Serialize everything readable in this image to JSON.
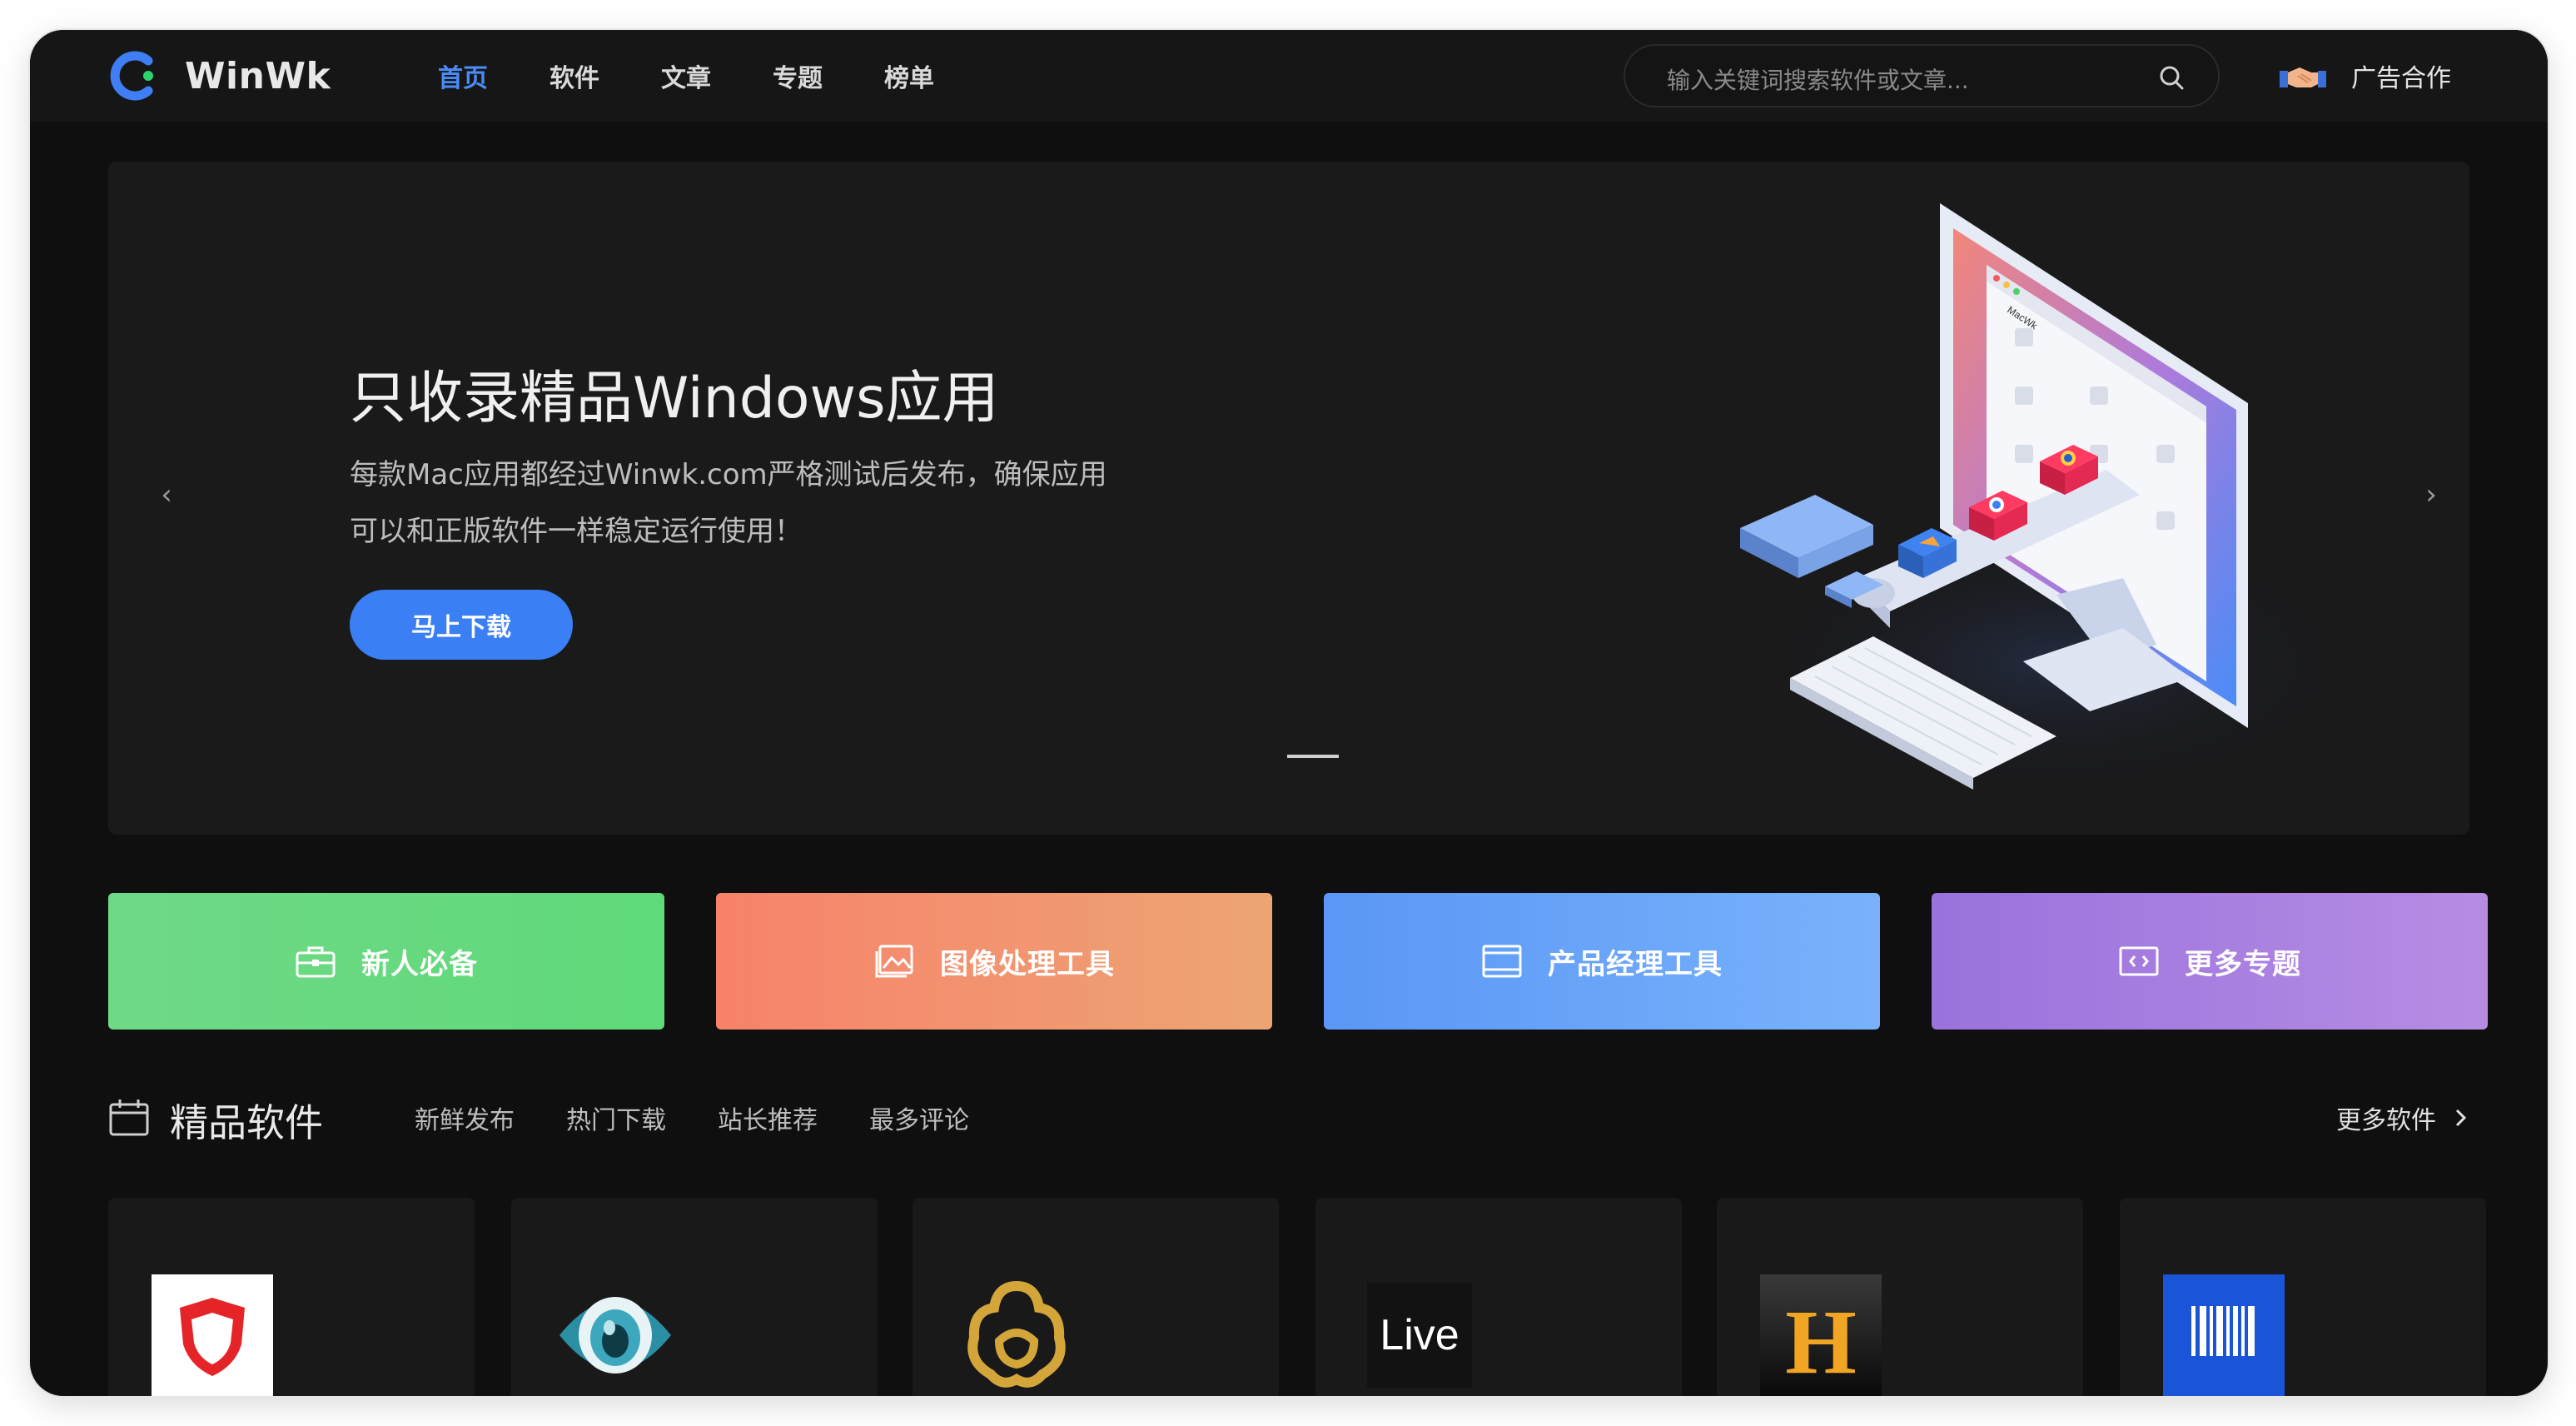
{
  "header": {
    "logo_text": "WinWk",
    "nav": [
      {
        "label": "首页",
        "active": true
      },
      {
        "label": "软件",
        "active": false
      },
      {
        "label": "文章",
        "active": false
      },
      {
        "label": "专题",
        "active": false
      },
      {
        "label": "榜单",
        "active": false
      }
    ],
    "search": {
      "placeholder": "输入关键词搜索软件或文章..."
    },
    "ad_label": "广告合作"
  },
  "banner": {
    "title": "只收录精品Windows应用",
    "desc_line1": "每款Mac应用都经过Winwk.com严格测试后发布，确保应用",
    "desc_line2": "可以和正版软件一样稳定运行使用！",
    "button_label": "马上下载",
    "prev_icon": "‹",
    "next_icon": "›",
    "illustration_window_label": "MacWk"
  },
  "categories": [
    {
      "label": "新人必备",
      "icon": "briefcase-icon"
    },
    {
      "label": "图像处理工具",
      "icon": "image-icon"
    },
    {
      "label": "产品经理工具",
      "icon": "window-icon"
    },
    {
      "label": "更多专题",
      "icon": "code-icon"
    }
  ],
  "section": {
    "title": "精品软件",
    "tabs": [
      "新鲜发布",
      "热门下载",
      "站长推荐",
      "最多评论"
    ],
    "more_label": "更多软件"
  },
  "apps": [
    {
      "icon": "shield-app-icon"
    },
    {
      "icon": "eye-app-icon"
    },
    {
      "icon": "navicat-app-icon"
    },
    {
      "icon": "live-app-icon",
      "text": "Live"
    },
    {
      "icon": "h-app-icon",
      "text": "H"
    },
    {
      "icon": "barcode-app-icon"
    }
  ],
  "colors": {
    "accent": "#4a8cf7",
    "button": "#3b7ff5",
    "background": "#0f0f10"
  }
}
